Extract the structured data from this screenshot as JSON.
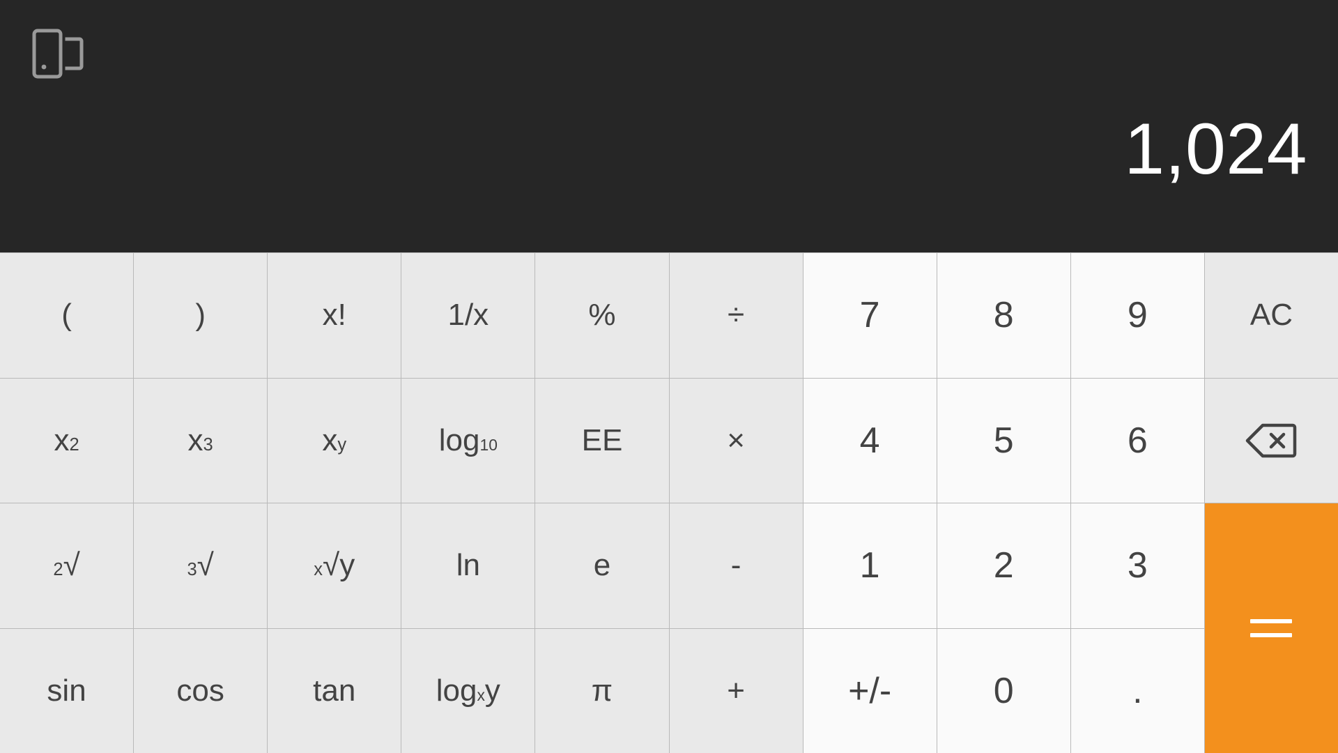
{
  "display": {
    "value": "1,024",
    "icon": "rotate-screen-icon",
    "background_color": "#262626",
    "text_color": "#ffffff"
  },
  "theme": {
    "scientific_key_bg": "#e9e9e9",
    "number_key_bg": "#fafafa",
    "equals_bg": "#f3901d",
    "key_text": "#434343",
    "divider": "#b9b9b9"
  },
  "keypad": {
    "rows": [
      [
        {
          "name": "open-paren",
          "label": "(",
          "type": "sci"
        },
        {
          "name": "close-paren",
          "label": ")",
          "type": "sci"
        },
        {
          "name": "factorial",
          "label": "x!",
          "type": "sci"
        },
        {
          "name": "reciprocal",
          "label": "1/x",
          "type": "sci"
        },
        {
          "name": "percent",
          "label": "%",
          "type": "sci"
        },
        {
          "name": "divide",
          "label": "÷",
          "type": "sci"
        },
        {
          "name": "digit-7",
          "label": "7",
          "type": "num"
        },
        {
          "name": "digit-8",
          "label": "8",
          "type": "num"
        },
        {
          "name": "digit-9",
          "label": "9",
          "type": "num"
        },
        {
          "name": "all-clear",
          "label": "AC",
          "type": "func"
        }
      ],
      [
        {
          "name": "x-squared",
          "label": "x2",
          "type": "sci"
        },
        {
          "name": "x-cubed",
          "label": "x3",
          "type": "sci"
        },
        {
          "name": "x-power-y",
          "label": "xy",
          "type": "sci"
        },
        {
          "name": "log-base-10",
          "label": "log10",
          "type": "sci"
        },
        {
          "name": "exponent-ee",
          "label": "EE",
          "type": "sci"
        },
        {
          "name": "multiply",
          "label": "×",
          "type": "sci"
        },
        {
          "name": "digit-4",
          "label": "4",
          "type": "num"
        },
        {
          "name": "digit-5",
          "label": "5",
          "type": "num"
        },
        {
          "name": "digit-6",
          "label": "6",
          "type": "num"
        },
        {
          "name": "backspace",
          "label": "backspace-icon",
          "type": "func"
        }
      ],
      [
        {
          "name": "square-root",
          "label": "2√",
          "type": "sci"
        },
        {
          "name": "cube-root",
          "label": "3√",
          "type": "sci"
        },
        {
          "name": "nth-root",
          "label": "x√y",
          "type": "sci"
        },
        {
          "name": "natural-log",
          "label": "ln",
          "type": "sci"
        },
        {
          "name": "euler-e",
          "label": "e",
          "type": "sci"
        },
        {
          "name": "subtract",
          "label": "-",
          "type": "sci"
        },
        {
          "name": "digit-1",
          "label": "1",
          "type": "num"
        },
        {
          "name": "digit-2",
          "label": "2",
          "type": "num"
        },
        {
          "name": "digit-3",
          "label": "3",
          "type": "num"
        },
        {
          "name": "equals",
          "label": "=",
          "type": "equals"
        }
      ],
      [
        {
          "name": "sine",
          "label": "sin",
          "type": "sci"
        },
        {
          "name": "cosine",
          "label": "cos",
          "type": "sci"
        },
        {
          "name": "tangent",
          "label": "tan",
          "type": "sci"
        },
        {
          "name": "log-base-x",
          "label": "logxy",
          "type": "sci"
        },
        {
          "name": "pi",
          "label": "π",
          "type": "sci"
        },
        {
          "name": "add",
          "label": "+",
          "type": "sci"
        },
        {
          "name": "sign-toggle",
          "label": "+/-",
          "type": "num"
        },
        {
          "name": "digit-0",
          "label": "0",
          "type": "num"
        },
        {
          "name": "decimal-point",
          "label": ".",
          "type": "num"
        }
      ]
    ]
  }
}
